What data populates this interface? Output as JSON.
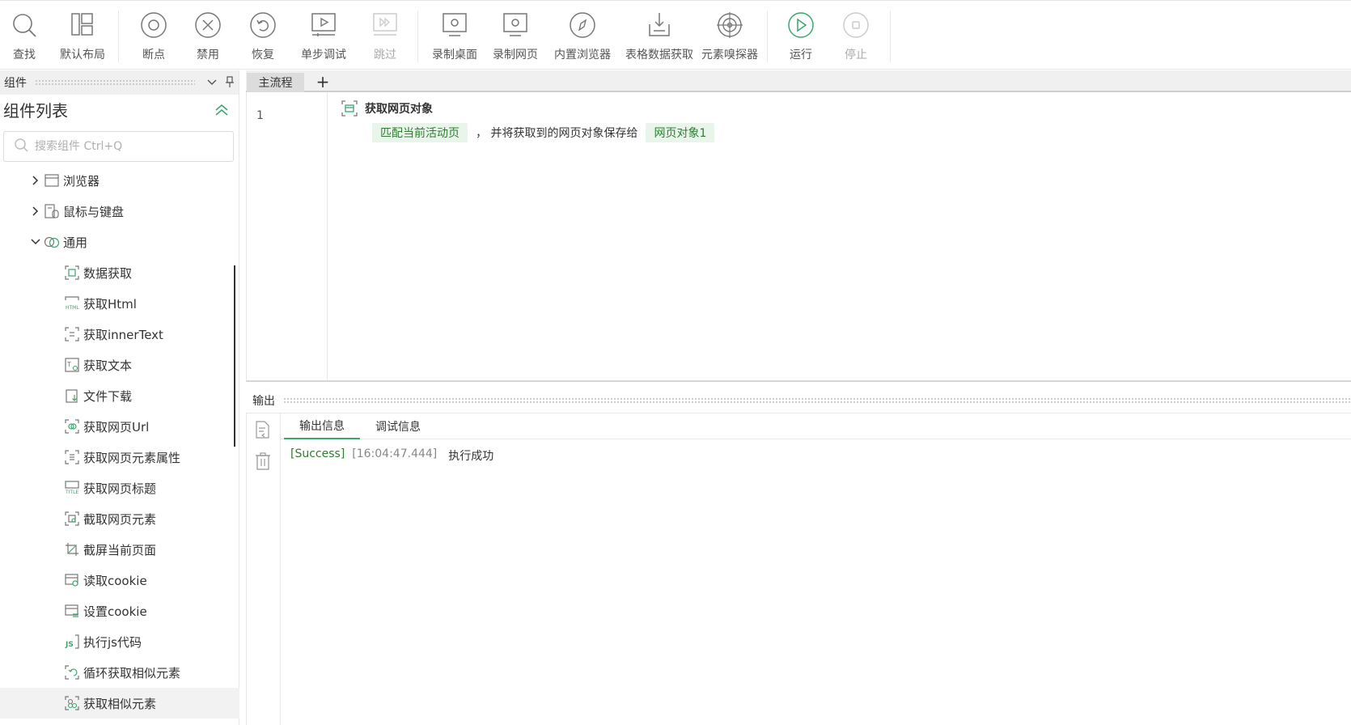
{
  "toolbar": {
    "find": "查找",
    "default_layout": "默认布局",
    "breakpoint": "断点",
    "disable": "禁用",
    "restore": "恢复",
    "step_debug": "单步调试",
    "skip": "跳过",
    "record_desktop": "录制桌面",
    "record_web": "录制网页",
    "builtin_browser": "内置浏览器",
    "table_data": "表格数据获取",
    "element_sniffer": "元素嗅探器",
    "run": "运行",
    "stop": "停止"
  },
  "left_panel": {
    "header": "组件",
    "title": "组件列表",
    "search_placeholder": "搜索组件 Ctrl+Q",
    "categories": [
      {
        "label": "浏览器",
        "expanded": false
      },
      {
        "label": "鼠标与键盘",
        "expanded": false
      },
      {
        "label": "通用",
        "expanded": true
      }
    ],
    "items": [
      "数据获取",
      "获取Html",
      "获取innerText",
      "获取文本",
      "文件下载",
      "获取网页Url",
      "获取网页元素属性",
      "获取网页标题",
      "截取网页元素",
      "截屏当前页面",
      "读取cookie",
      "设置cookie",
      "执行js代码",
      "循环获取相似元素",
      "获取相似元素"
    ],
    "selected_item": "获取相似元素"
  },
  "editor": {
    "tab_main": "主流程",
    "tab_add": "+",
    "line_number": "1",
    "step_title": "获取网页对象",
    "param_match": "匹配当前活动页",
    "connector": "， 并将获取到的网页对象保存给",
    "param_var": "网页对象1"
  },
  "output": {
    "header": "输出",
    "tab_output": "输出信息",
    "tab_debug": "调试信息",
    "log_level": "[Success]",
    "log_time": "[16:04:47.444]",
    "log_message": "执行成功"
  },
  "colors": {
    "accent_green": "#3aa76d",
    "tag_bg": "#e9f5ea",
    "tag_text": "#2e7d32",
    "icon_gray": "#777777"
  }
}
